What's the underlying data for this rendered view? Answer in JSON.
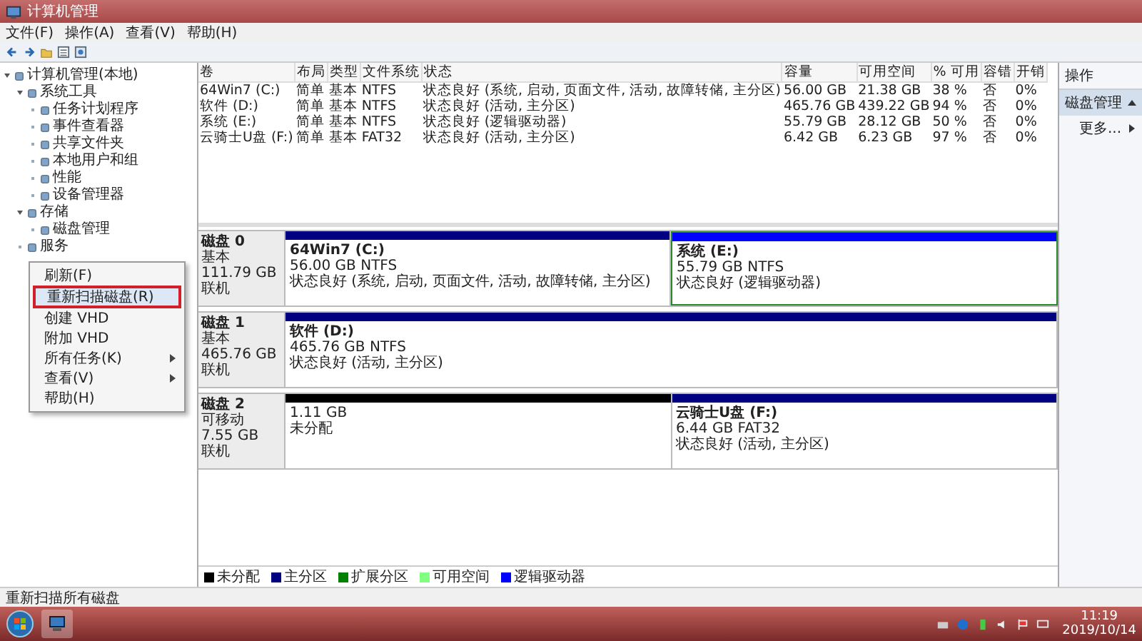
{
  "window": {
    "title": "计算机管理"
  },
  "menu": [
    "文件(F)",
    "操作(A)",
    "查看(V)",
    "帮助(H)"
  ],
  "tree": [
    {
      "label": "计算机管理(本地)",
      "expanded": true,
      "children": [
        {
          "label": "系统工具",
          "expanded": true,
          "children": [
            {
              "label": "任务计划程序",
              "expanded": false
            },
            {
              "label": "事件查看器",
              "expanded": false
            },
            {
              "label": "共享文件夹",
              "expanded": false
            },
            {
              "label": "本地用户和组",
              "expanded": false
            },
            {
              "label": "性能",
              "expanded": false
            },
            {
              "label": "设备管理器",
              "expanded": false
            }
          ]
        },
        {
          "label": "存储",
          "expanded": true,
          "children": [
            {
              "label": "磁盘管理",
              "expanded": false
            }
          ]
        },
        {
          "label": "服务",
          "expanded": false
        }
      ]
    }
  ],
  "context_menu": [
    {
      "label": "刷新(F)",
      "selected": false,
      "submenu": false
    },
    {
      "label": "重新扫描磁盘(R)",
      "selected": true,
      "submenu": false
    },
    {
      "label": "创建 VHD",
      "selected": false,
      "submenu": false
    },
    {
      "label": "附加 VHD",
      "selected": false,
      "submenu": false
    },
    {
      "label": "所有任务(K)",
      "selected": false,
      "submenu": true
    },
    {
      "label": "查看(V)",
      "selected": false,
      "submenu": true
    },
    {
      "label": "帮助(H)",
      "selected": false,
      "submenu": false
    }
  ],
  "table": {
    "columns": [
      "卷",
      "布局",
      "类型",
      "文件系统",
      "状态",
      "容量",
      "可用空间",
      "% 可用",
      "容错",
      "开销"
    ],
    "rows": [
      [
        "64Win7 (C:)",
        "简单",
        "基本",
        "NTFS",
        "状态良好 (系统, 启动, 页面文件, 活动, 故障转储, 主分区)",
        "56.00 GB",
        "21.38 GB",
        "38 %",
        "否",
        "0%"
      ],
      [
        "软件 (D:)",
        "简单",
        "基本",
        "NTFS",
        "状态良好 (活动, 主分区)",
        "465.76 GB",
        "439.22 GB",
        "94 %",
        "否",
        "0%"
      ],
      [
        "系统 (E:)",
        "简单",
        "基本",
        "NTFS",
        "状态良好 (逻辑驱动器)",
        "55.79 GB",
        "28.12 GB",
        "50 %",
        "否",
        "0%"
      ],
      [
        "云骑士U盘 (F:)",
        "简单",
        "基本",
        "FAT32",
        "状态良好 (活动, 主分区)",
        "6.42 GB",
        "6.23 GB",
        "97 %",
        "否",
        "0%"
      ]
    ]
  },
  "disks": [
    {
      "name": "磁盘 0",
      "type": "基本",
      "size": "111.79 GB",
      "status": "联机",
      "partitions": [
        {
          "kind": "primary",
          "name": "64Win7  (C:)",
          "size": "56.00 GB NTFS",
          "status": "状态良好 (系统, 启动, 页面文件, 活动, 故障转储, 主分区)"
        },
        {
          "kind": "logical",
          "name": "系统  (E:)",
          "size": "55.79 GB NTFS",
          "status": "状态良好 (逻辑驱动器)"
        }
      ]
    },
    {
      "name": "磁盘 1",
      "type": "基本",
      "size": "465.76 GB",
      "status": "联机",
      "partitions": [
        {
          "kind": "primary",
          "name": "软件  (D:)",
          "size": "465.76 GB NTFS",
          "status": "状态良好 (活动, 主分区)"
        }
      ]
    },
    {
      "name": "磁盘 2",
      "type": "可移动",
      "size": "7.55 GB",
      "status": "联机",
      "partitions": [
        {
          "kind": "unallocated",
          "size": "1.11 GB",
          "status": "未分配"
        },
        {
          "kind": "primary",
          "name": "云骑士U盘  (F:)",
          "size": "6.44 GB FAT32",
          "status": "状态良好 (活动, 主分区)"
        }
      ]
    }
  ],
  "legend": [
    {
      "label": "未分配",
      "color": "#000000"
    },
    {
      "label": "主分区",
      "color": "#000080"
    },
    {
      "label": "扩展分区",
      "color": "#008000"
    },
    {
      "label": "可用空间",
      "color": "#80ff80"
    },
    {
      "label": "逻辑驱动器",
      "color": "#0000ff"
    }
  ],
  "actions": {
    "title": "操作",
    "section": "磁盘管理",
    "more": "更多..."
  },
  "status_bar": "重新扫描所有磁盘",
  "taskbar": {
    "time": "11:19",
    "date": "2019/10/14"
  }
}
